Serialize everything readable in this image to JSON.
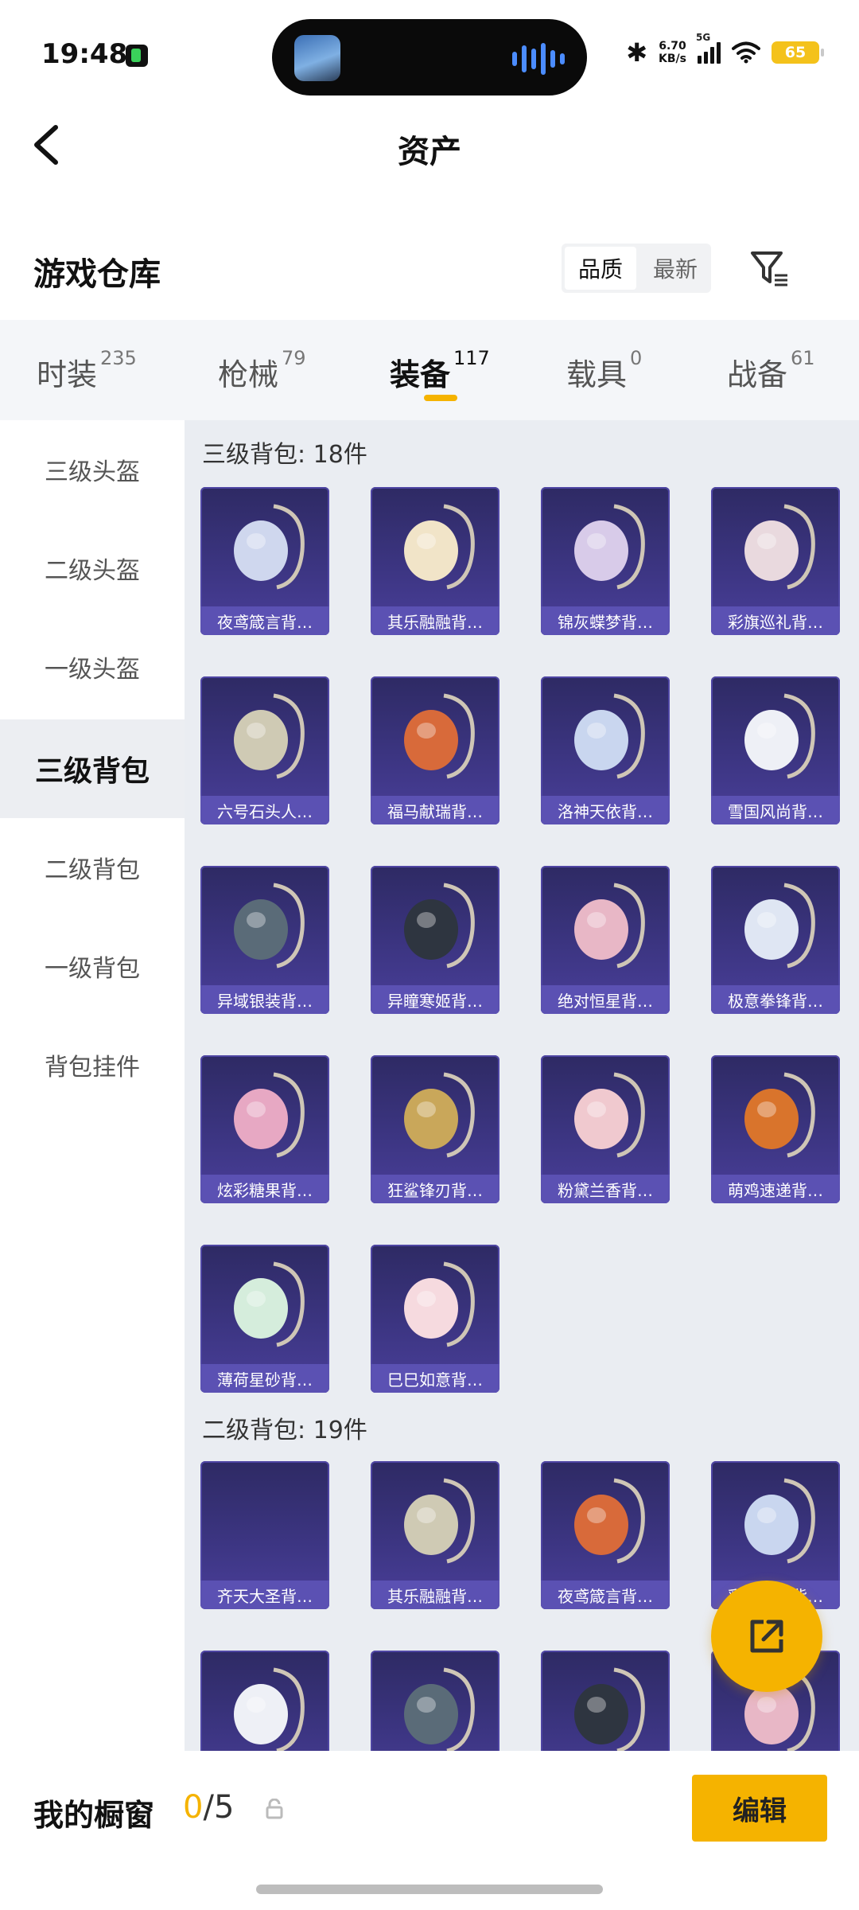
{
  "status_bar": {
    "time": "19:48",
    "speed_value": "6.70",
    "speed_unit": "KB/s",
    "network": "5G",
    "battery": "65"
  },
  "header": {
    "title": "资产",
    "back_icon": "chevron-left-icon"
  },
  "warehouse": {
    "title": "游戏仓库",
    "sort_options": [
      "品质",
      "最新"
    ],
    "sort_active": "品质",
    "filter_icon": "filter-icon"
  },
  "tabs": [
    {
      "label": "时装",
      "count": "235"
    },
    {
      "label": "枪械",
      "count": "79"
    },
    {
      "label": "装备",
      "count": "117",
      "active": true
    },
    {
      "label": "载具",
      "count": "0"
    },
    {
      "label": "战备",
      "count": "61"
    }
  ],
  "sidebar": {
    "items": [
      "三级头盔",
      "二级头盔",
      "一级头盔",
      "三级背包",
      "二级背包",
      "一级背包",
      "背包挂件"
    ],
    "active_index": 3
  },
  "groups": [
    {
      "title": "三级背包: 18件",
      "items": [
        "夜鸢箴言背…",
        "其乐融融背…",
        "锦灰蝶梦背…",
        "彩旗巡礼背…",
        "六号石头人…",
        "福马献瑞背…",
        "洛神天依背…",
        "雪国风尚背…",
        "异域银装背…",
        "异瞳寒姬背…",
        "绝对恒星背…",
        "极意拳锋背…",
        "炫彩糖果背…",
        "狂鲨锋刃背…",
        "粉黛兰香背…",
        "萌鸡速递背…",
        "薄荷星砂背…",
        "巳巳如意背…"
      ]
    },
    {
      "title": "二级背包: 19件",
      "items": [
        "齐天大圣背…",
        "其乐融融背…",
        "夜鸢箴言背…",
        "彩旗巡礼背…",
        "",
        "",
        "",
        ""
      ]
    }
  ],
  "bottom_bar": {
    "label": "我的橱窗",
    "current": "0",
    "separator": "/",
    "max": "5",
    "edit_label": "编辑",
    "lock_icon": "lock-icon"
  },
  "fab": {
    "icon": "share-external-icon"
  },
  "colors": {
    "accent": "#f5b300",
    "card_bg": "#3c3582",
    "card_label": "#5b51b3",
    "content_bg": "#eaedf2"
  }
}
